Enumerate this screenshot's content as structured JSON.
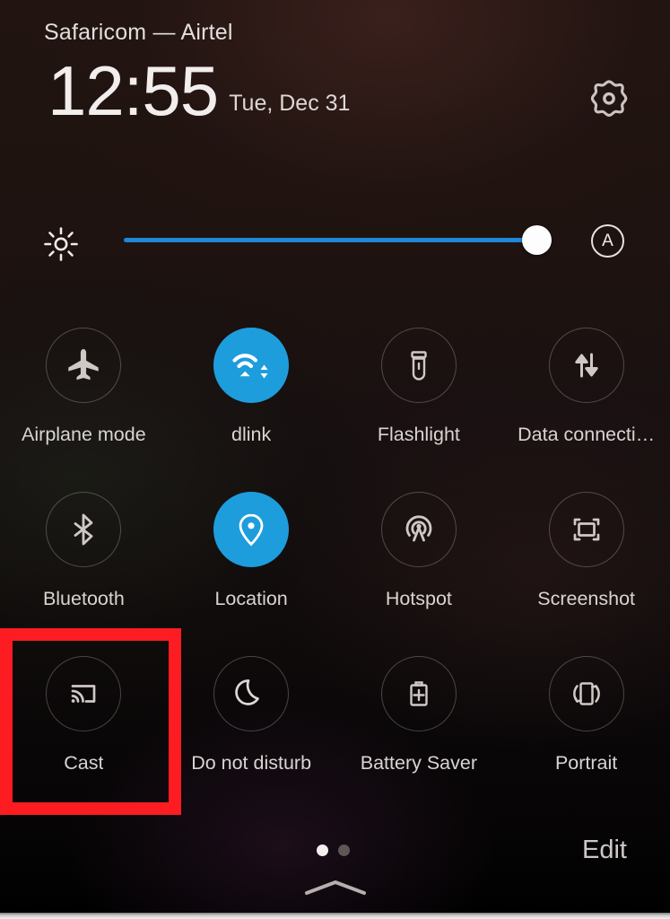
{
  "statusbar": {
    "carrier": "Safaricom — Airtel"
  },
  "header": {
    "time": "12:55",
    "date": "Tue, Dec 31",
    "settings_icon": "gear-icon"
  },
  "brightness": {
    "icon": "brightness-sun-icon",
    "auto_label": "A",
    "auto_icon": "auto-brightness-icon",
    "level_percent": 96,
    "track_color": "#1e88d6",
    "thumb_color": "#fdfdfd"
  },
  "theme": {
    "active_tile_color": "#1e9ddc",
    "label_color": "#d9d4d2",
    "panel_background": "#1e1310",
    "highlight_color": "#fc1c21"
  },
  "tiles": {
    "rows": [
      [
        {
          "label": "Airplane mode",
          "icon": "airplane-icon",
          "active": false
        },
        {
          "label": "dlink",
          "icon": "wifi-icon",
          "active": true
        },
        {
          "label": "Flashlight",
          "icon": "flashlight-icon",
          "active": false
        },
        {
          "label": "Data connecti…",
          "icon": "data-transfer-icon",
          "active": false
        }
      ],
      [
        {
          "label": "Bluetooth",
          "icon": "bluetooth-icon",
          "active": false
        },
        {
          "label": "Location",
          "icon": "location-pin-icon",
          "active": true
        },
        {
          "label": "Hotspot",
          "icon": "hotspot-icon",
          "active": false
        },
        {
          "label": "Screenshot",
          "icon": "screenshot-icon",
          "active": false
        }
      ],
      [
        {
          "label": "Cast",
          "icon": "cast-icon",
          "active": false
        },
        {
          "label": "Do not disturb",
          "icon": "moon-icon",
          "active": false
        },
        {
          "label": "Battery Saver",
          "icon": "battery-plus-icon",
          "active": false
        },
        {
          "label": "Portrait",
          "icon": "screen-rotation-icon",
          "active": false
        }
      ]
    ]
  },
  "footer": {
    "page_dots": [
      "active",
      "inactive"
    ],
    "current_page": 1,
    "total_pages": 2,
    "collapse_icon": "chevron-up-icon",
    "edit_label": "Edit"
  },
  "annotation": {
    "target": "Cast",
    "color": "#fc1c21"
  }
}
